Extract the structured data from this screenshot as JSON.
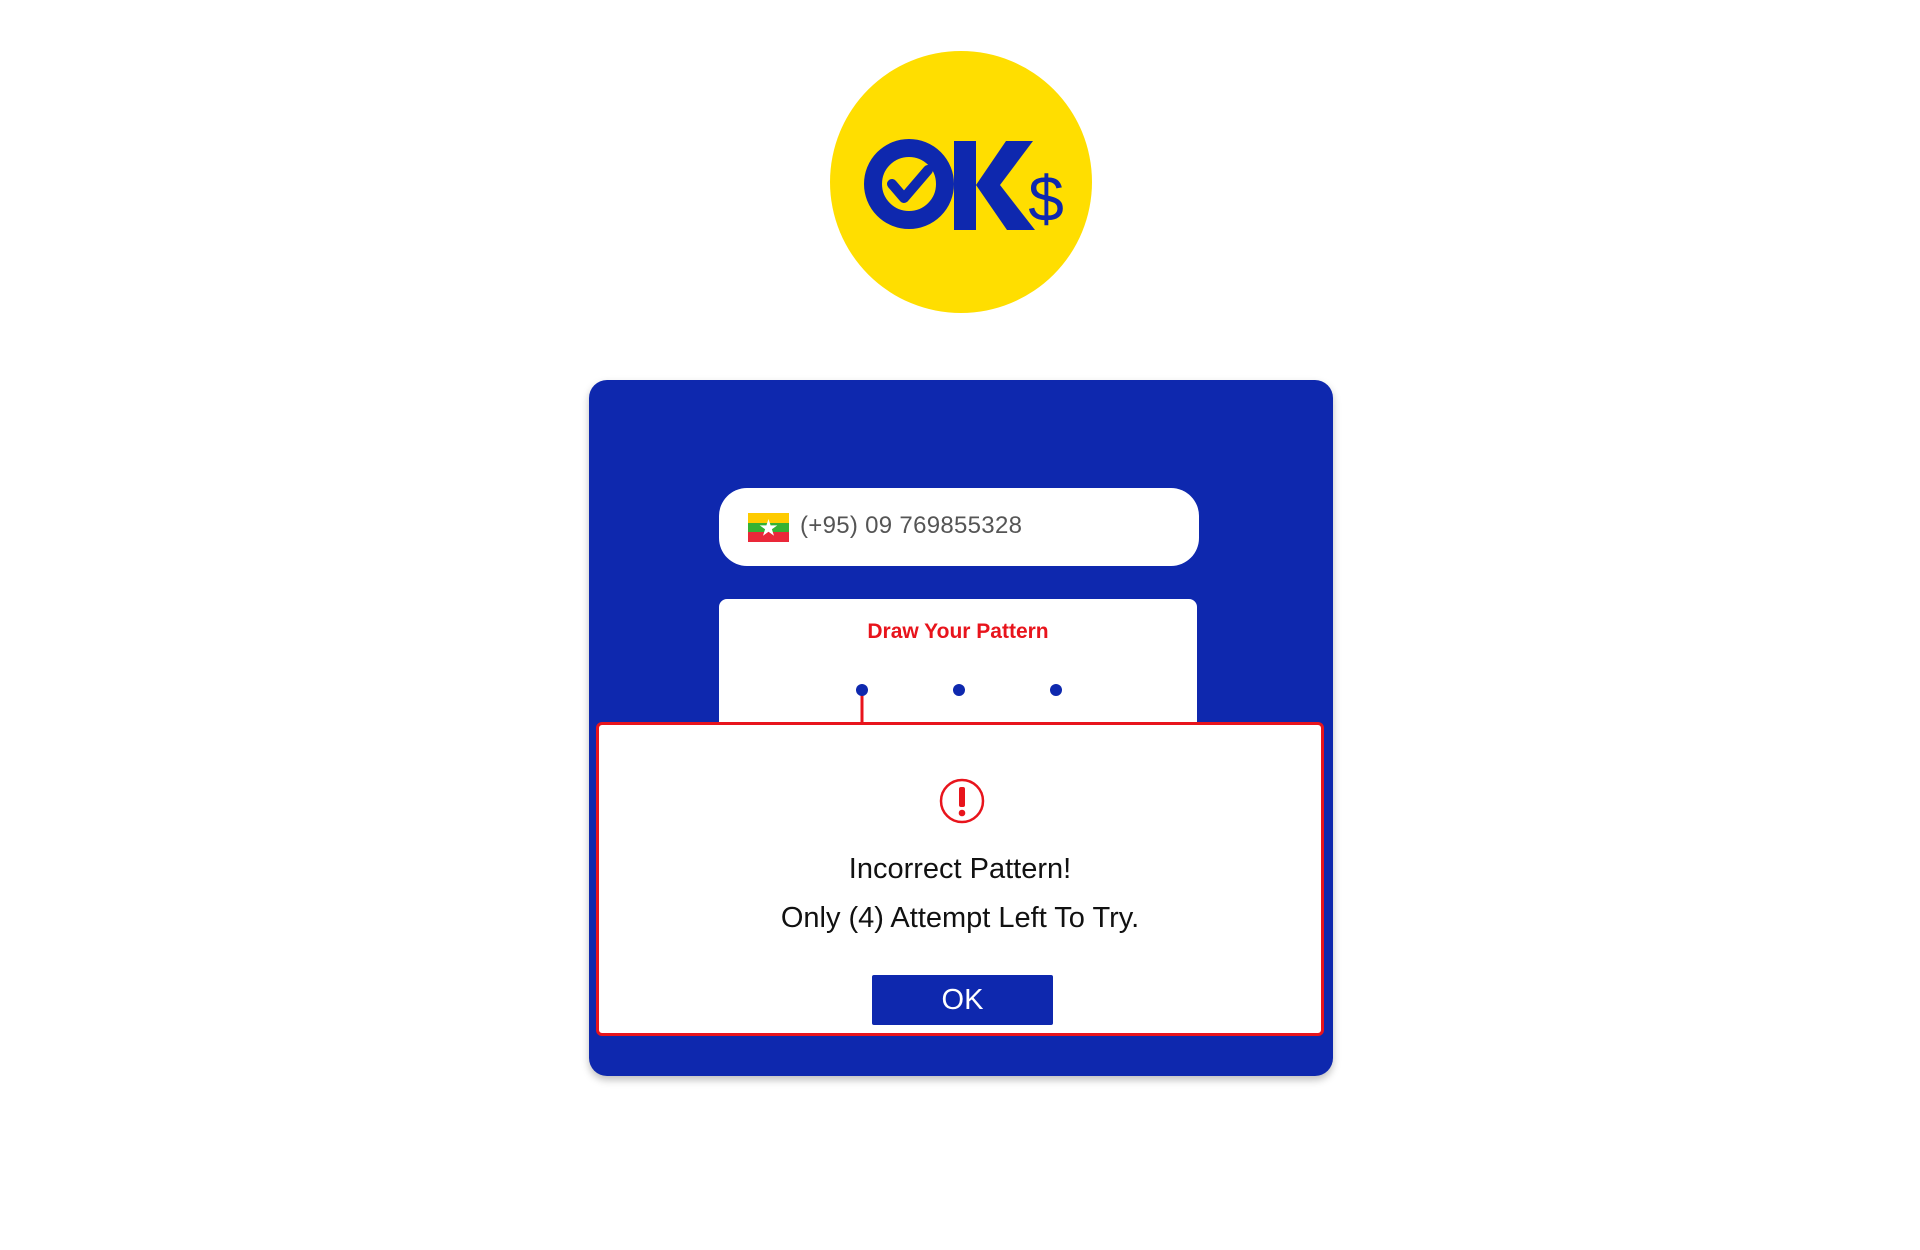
{
  "logo": {
    "text": "OK$",
    "colors": {
      "background": "#FFDE00",
      "foreground": "#0E28AE"
    }
  },
  "login": {
    "flag_icon": "myanmar-flag-icon",
    "phone_number": "(+95) 09 769855328",
    "pattern_title": "Draw Your Pattern"
  },
  "dialog": {
    "icon": "alert-icon",
    "title": "Incorrect Pattern!",
    "message": "Only (4) Attempt Left To Try.",
    "ok_label": "OK"
  },
  "colors": {
    "card": "#0E28AE",
    "alert": "#E8141C",
    "button": "#0E28AE"
  }
}
